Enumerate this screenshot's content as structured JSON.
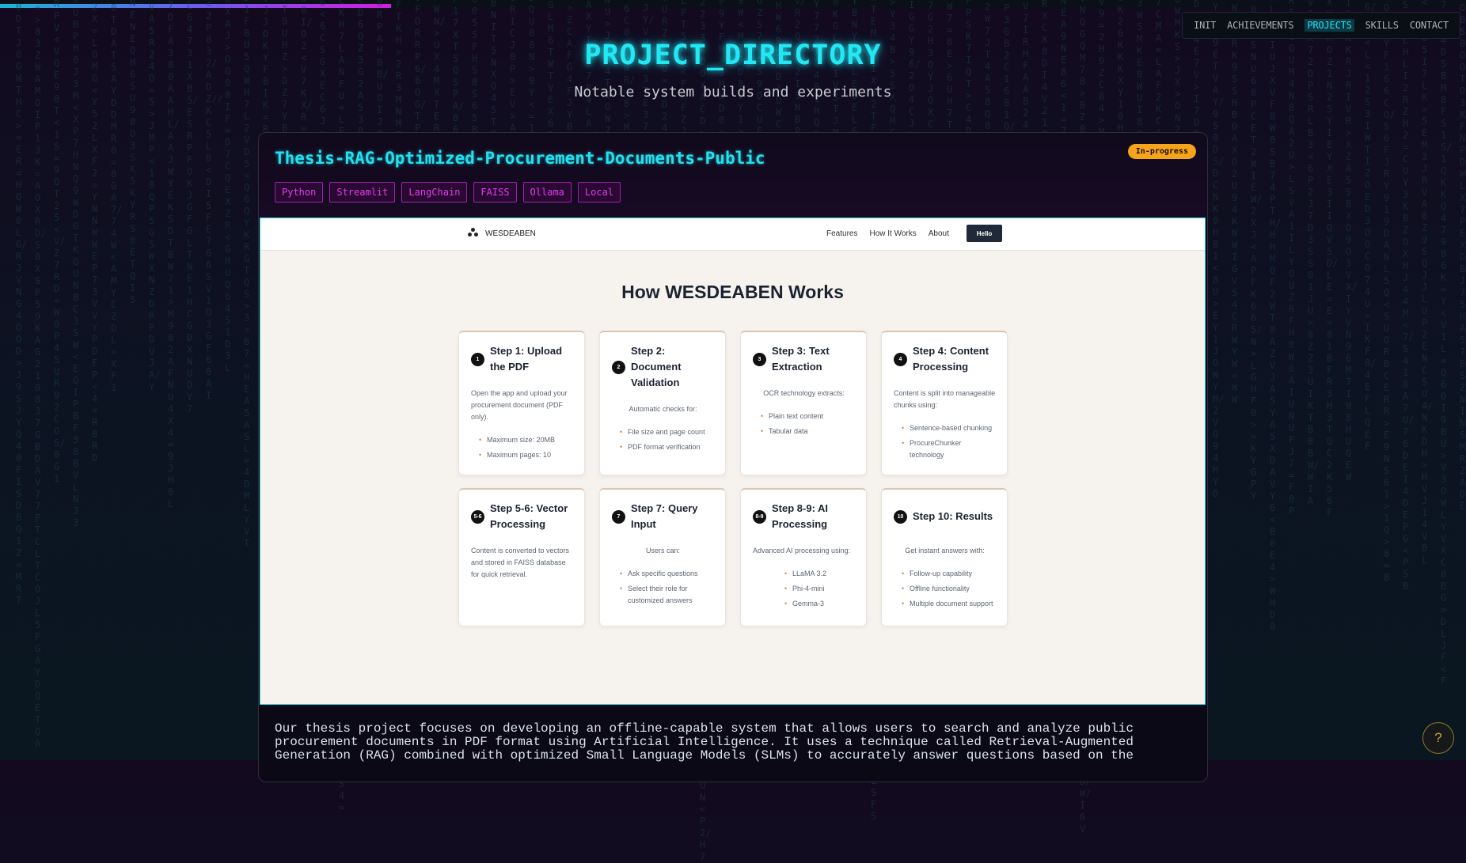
{
  "nav": {
    "items": [
      "INIT",
      "ACHIEVEMENTS",
      "PROJECTS",
      "SKILLS",
      "CONTACT"
    ],
    "active": "PROJECTS"
  },
  "scroll_progress": 0.267,
  "header": {
    "title": "PROJECT_DIRECTORY",
    "subtitle": "Notable system builds and experiments"
  },
  "project": {
    "title": "Thesis-RAG-Optimized-Procurement-Documents-Public",
    "status": "In-progress",
    "tags": [
      "Python",
      "Streamlit",
      "LangChain",
      "FAISS",
      "Ollama",
      "Local"
    ],
    "description": "Our thesis project focuses on developing an offline-capable system that allows users to search and analyze public procurement documents in PDF format using Artificial Intelligence. It uses a technique called Retrieval-Augmented Generation (RAG) combined with optimized Small Language Models (SLMs) to accurately answer questions based on the"
  },
  "screenshot": {
    "brand": "WESDEABEN",
    "nav_links": [
      "Features",
      "How It Works",
      "About"
    ],
    "nav_button": "Hello",
    "heading": "How WESDEABEN Works",
    "steps": [
      {
        "num": "1",
        "title": "Step 1: Upload the PDF",
        "desc": "Open the app and upload your procurement document (PDF only).",
        "align": "left",
        "bullets": [
          "Maximum size: 20MB",
          "Maximum pages: 10"
        ]
      },
      {
        "num": "2",
        "title": "Step 2: Document Validation",
        "desc": "Automatic checks for:",
        "align": "center",
        "bullets": [
          "File size and page count",
          "PDF format verification"
        ]
      },
      {
        "num": "3",
        "title": "Step 3: Text Extraction",
        "desc": "OCR technology extracts:",
        "align": "center",
        "bullets": [
          "Plain text content",
          "Tabular data"
        ]
      },
      {
        "num": "4",
        "title": "Step 4: Content Processing",
        "desc": "Content is split into manageable chunks using:",
        "align": "left",
        "bullets": [
          "Sentence-based chunking",
          "ProcureChunker technology"
        ]
      },
      {
        "num": "5-6",
        "title": "Step 5-6: Vector Processing",
        "desc": "Content is converted to vectors and stored in FAISS database for quick retrieval.",
        "align": "left",
        "bullets": []
      },
      {
        "num": "7",
        "title": "Step 7: Query Input",
        "desc": "Users can:",
        "align": "center",
        "bullets": [
          "Ask specific questions",
          "Select their role for customized answers"
        ]
      },
      {
        "num": "8-9",
        "title": "Step 8-9: AI Processing",
        "desc": "Advanced AI processing using:",
        "align": "left",
        "bullets": [
          "LLaMA 3.2",
          "Phi-4-mini",
          "Gemma-3"
        ]
      },
      {
        "num": "10",
        "title": "Step 10: Results",
        "desc": "Get instant answers with:",
        "align": "center",
        "bullets": [
          "Follow-up capability",
          "Offline functionality",
          "Multiple document support"
        ]
      }
    ]
  },
  "help_button": "?",
  "colors": {
    "accent_cyan": "#22e8f4",
    "tag_magenta": "#e23bf0",
    "status_orange": "#f4a51c"
  }
}
